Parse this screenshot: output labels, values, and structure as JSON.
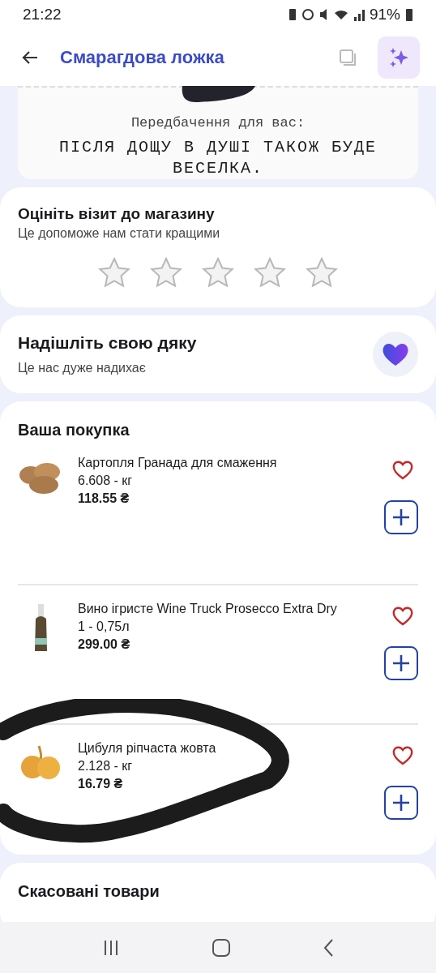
{
  "status_bar": {
    "time": "21:22",
    "battery": "91%"
  },
  "header": {
    "title": "Смарагдова ложка"
  },
  "prediction": {
    "label": "Передбачення для вас:",
    "text": "ПІСЛЯ ДОЩУ В ДУШІ ТАКОЖ БУДЕ ВЕСЕЛКА."
  },
  "rating": {
    "title": "Оцініть візит до магазину",
    "subtitle": "Це допоможе нам стати кращими",
    "stars": 0
  },
  "thanks": {
    "title": "Надішліть свою дяку",
    "subtitle": "Це нас дуже надихає"
  },
  "purchase": {
    "title": "Ваша покупка",
    "items": [
      {
        "kind": "potato",
        "name": "Картопля Гранада для смаження",
        "quantity": "6.608 - кг",
        "price": "118.55 ₴",
        "favorite": false
      },
      {
        "kind": "bottle",
        "name": "Вино ігристе Wine Truck Prosecco Extra Dry",
        "quantity": "1 - 0,75л",
        "price": "299.00 ₴",
        "favorite": false
      },
      {
        "kind": "onion",
        "name": "Цибуля ріпчаста жовта",
        "quantity": "2.128 - кг",
        "price": "16.79 ₴",
        "favorite": false,
        "circled": true
      }
    ]
  },
  "cancelled": {
    "title": "Скасовані товари"
  }
}
